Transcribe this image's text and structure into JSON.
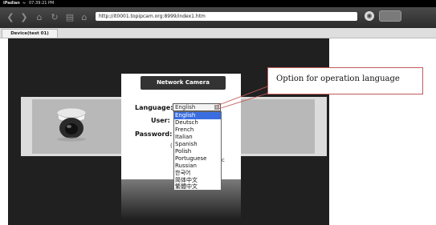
{
  "status_bar": {
    "carrier": "iPadian",
    "time": "07:39:21 PM"
  },
  "browser": {
    "url": "http://it0001.topipcam.org:8999/index1.htm",
    "tab_label": "Device(test 01)"
  },
  "login": {
    "header": "Network Camera",
    "language_label": "Language:",
    "user_label": "User:",
    "password_label": "Password:",
    "selected_language": "English"
  },
  "languages": [
    "English",
    "Deutsch",
    "French",
    "Italian",
    "Spanish",
    "Polish",
    "Portuguese",
    "Russian",
    "한국어",
    "简体中文",
    "繁體中文"
  ],
  "callout": {
    "text": "Option for operation language"
  }
}
